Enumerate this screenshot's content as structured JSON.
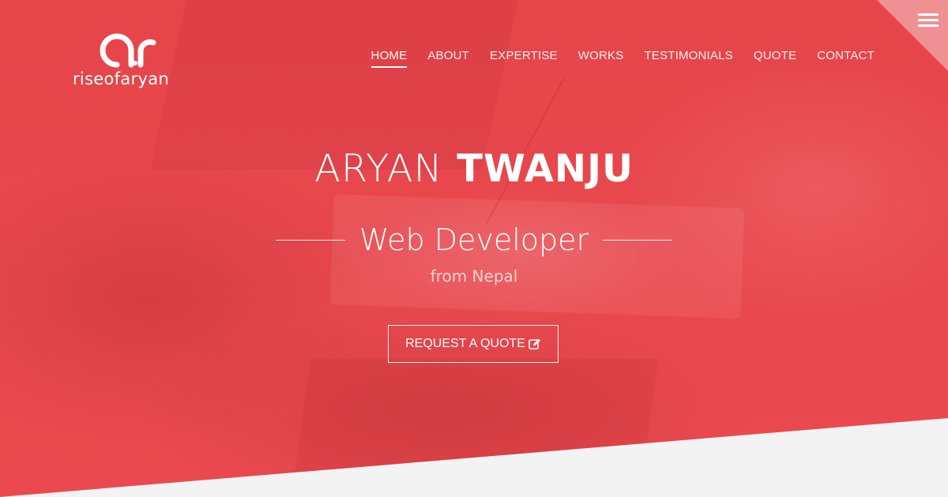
{
  "brand": {
    "logo_text": "riseofaryan",
    "logo_mark_icon": "ar-monogram-icon"
  },
  "nav": {
    "items": [
      {
        "label": "HOME",
        "active": true
      },
      {
        "label": "ABOUT",
        "active": false
      },
      {
        "label": "EXPERTISE",
        "active": false
      },
      {
        "label": "WORKS",
        "active": false
      },
      {
        "label": "TESTIMONIALS",
        "active": false
      },
      {
        "label": "QUOTE",
        "active": false
      },
      {
        "label": "CONTACT",
        "active": false
      }
    ],
    "menu_icon": "hamburger-menu-icon"
  },
  "hero": {
    "first_name": "ARYAN",
    "last_name": "TWANJU",
    "role": "Web Developer",
    "location": "from Nepal",
    "cta_label": "REQUEST A QUOTE",
    "cta_icon": "edit-icon"
  },
  "colors": {
    "accent": "#e8454a",
    "bottom_band": "#f3f3f3",
    "text": "#ffffff"
  }
}
